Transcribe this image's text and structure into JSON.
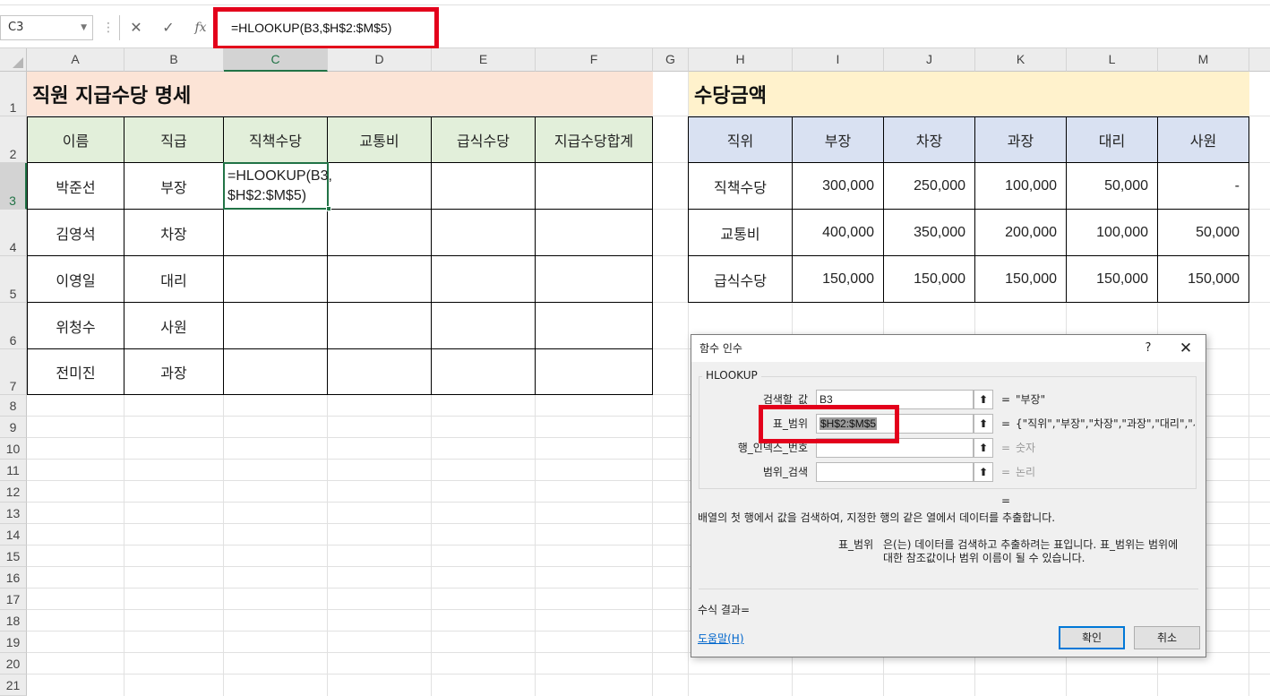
{
  "formula_bar": {
    "name_box": "C3",
    "cancel_icon": "✕",
    "enter_icon": "✓",
    "fx_icon": "fx",
    "formula": "=HLOOKUP(B3,$H$2:$M$5)"
  },
  "columns": [
    "A",
    "B",
    "C",
    "D",
    "E",
    "F",
    "G",
    "H",
    "I",
    "J",
    "K",
    "L",
    "M"
  ],
  "rows": [
    "1",
    "2",
    "3",
    "4",
    "5",
    "6",
    "7",
    "8",
    "9",
    "10",
    "11",
    "12",
    "13",
    "14",
    "15",
    "16",
    "17",
    "18",
    "19",
    "20",
    "21"
  ],
  "left_table": {
    "title": "직원 지급수당 명세",
    "headers": [
      "이름",
      "직급",
      "직책수당",
      "교통비",
      "급식수당",
      "지급수당합계"
    ],
    "rows": [
      {
        "name": "박준선",
        "rank": "부장"
      },
      {
        "name": "김영석",
        "rank": "차장"
      },
      {
        "name": "이영일",
        "rank": "대리"
      },
      {
        "name": "위청수",
        "rank": "사원"
      },
      {
        "name": "전미진",
        "rank": "과장"
      }
    ],
    "editing_line1": "=HLOOKUP(B3,",
    "editing_line2": "$H$2:$M$5)"
  },
  "right_table": {
    "title": "수당금액",
    "headers": [
      "직위",
      "부장",
      "차장",
      "과장",
      "대리",
      "사원"
    ],
    "rows": [
      {
        "label": "직책수당",
        "values": [
          "300,000",
          "250,000",
          "100,000",
          "50,000",
          "-"
        ]
      },
      {
        "label": "교통비",
        "values": [
          "400,000",
          "350,000",
          "200,000",
          "100,000",
          "50,000"
        ]
      },
      {
        "label": "급식수당",
        "values": [
          "150,000",
          "150,000",
          "150,000",
          "150,000",
          "150,000"
        ]
      }
    ]
  },
  "dialog": {
    "title": "함수 인수",
    "help": "?",
    "close": "✕",
    "function_name": "HLOOKUP",
    "args": [
      {
        "label": "검색할_값",
        "value": "B3",
        "eq": "=",
        "result": "\"부장\""
      },
      {
        "label": "표_범위",
        "value": "$H$2:$M$5",
        "eq": "=",
        "result": "{\"직위\",\"부장\",\"차장\",\"과장\",\"대리\",\"사원\""
      },
      {
        "label": "행_인덱스_번호",
        "value": "",
        "eq": "=",
        "result": "숫자"
      },
      {
        "label": "범위_검색",
        "value": "",
        "eq": "=",
        "result": "논리"
      }
    ],
    "ref_icon": "⬆",
    "result_eq": "=",
    "description": "배열의 첫 행에서 값을 검색하여, 지정한 행의 같은 열에서 데이터를 추출합니다.",
    "arg_desc_name": "표_범위",
    "arg_desc_line1": "은(는) 데이터를 검색하고 추출하려는 표입니다. 표_범위는 범위에",
    "arg_desc_line2": "대한 참조값이나 범위 이름이 될 수 있습니다.",
    "formula_result": "수식 결과=",
    "help_link": "도움말(H)",
    "ok": "확인",
    "cancel": "취소"
  },
  "colors": {
    "left_title_bg": "#fce4d6",
    "left_header_bg": "#e2efda",
    "right_title_bg": "#fff2cc",
    "right_header_bg": "#d9e1f2",
    "highlight_red": "#e3001b",
    "excel_green": "#217346"
  }
}
